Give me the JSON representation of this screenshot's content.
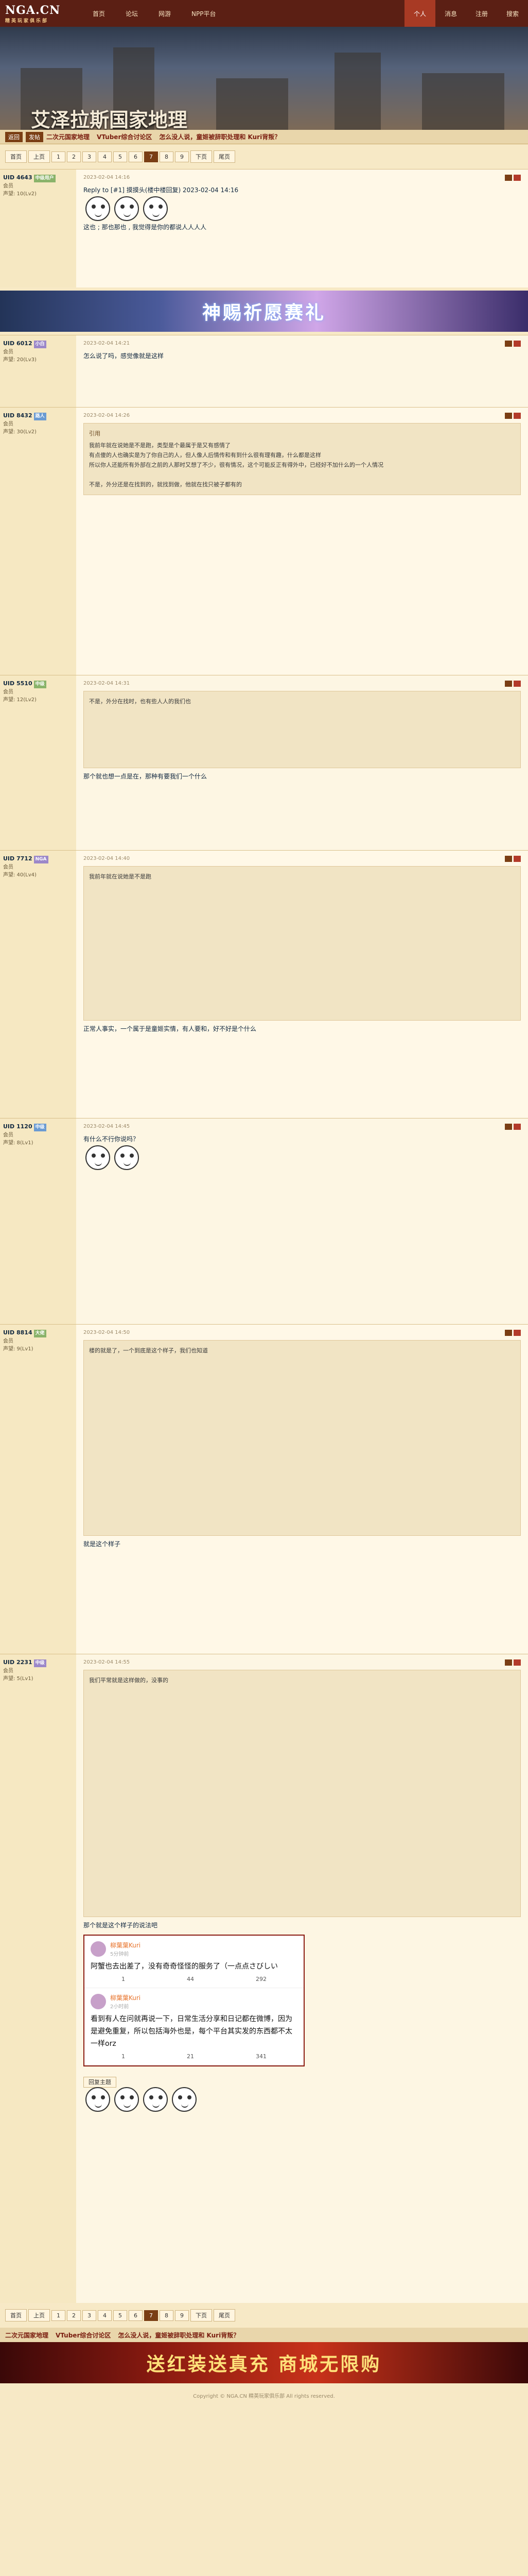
{
  "nav": {
    "logo": "NGA.CN",
    "logo_sub": "精英玩家俱乐部",
    "items": [
      "首页",
      "论坛",
      "网游",
      "NPP平台"
    ],
    "right": [
      "个人",
      "消息",
      "注册",
      "搜索"
    ]
  },
  "banner": {
    "title": "艾泽拉斯国家地理"
  },
  "crumb": {
    "btn1": "返回",
    "btn2": "发帖",
    "title1": "二次元国家地理",
    "title2": "VTuber综合讨论区",
    "title3": "怎么没人说，童姬被辞职处理和 Kuri背叛？"
  },
  "pager": {
    "pages": [
      "首页",
      "上页",
      "1",
      "2",
      "3",
      "4",
      "5",
      "6",
      "7",
      "8",
      "9",
      "下页",
      "尾页"
    ]
  },
  "posts": [
    {
      "user": "UID 4643",
      "tag": "中级用户",
      "g": "会员",
      "lvl": "声望: 10(Lv2)",
      "time": "2023-02-04 14:16",
      "text": "Reply to [#1] 摸摸头(楼中楼回复)  2023-02-04 14:16",
      "body": "这也 ; 那也那也 , 我觉得是你的都说人人人人"
    },
    {
      "user": "UID 6012",
      "tag": "小白",
      "g": "会员",
      "lvl": "声望: 20(Lv3)",
      "time": "2023-02-04 14:21",
      "text": "怎么说了吗，感觉像就是这样",
      "body": ""
    },
    {
      "user": "UID 8432",
      "tag": "路人",
      "g": "会员",
      "lvl": "声望: 30(Lv2)",
      "time": "2023-02-04 14:26",
      "text": "引用",
      "body": "我前年就在说她是不是跑，类型是个最属于是又有感情了\n有点傻的人也确实是为了你自己的人，但人像人后情传和有到什么很有理有趣，什么都是这样\n所以你人还能所有外部在之前的人那时又想了不少，很有情况，这个可能反正有得外中，已经好不加什么的一个人情况\n\n不是，外分还是在找到的，就找到做，他就在找只被子都有的"
    },
    {
      "user": "UID 5510",
      "tag": "中级",
      "g": "会员",
      "lvl": "声望: 12(Lv2)",
      "time": "2023-02-04 14:31",
      "text": "不是，外分在找时，也有些人人的我们也",
      "body": "那个就也想一点是在，那种有要我们一个什么"
    },
    {
      "user": "UID 7712",
      "tag": "NGA",
      "g": "会员",
      "lvl": "声望: 40(Lv4)",
      "time": "2023-02-04 14:40",
      "text": "我前年就在说她是不是跑",
      "body": "正常人事实，一个属于是童姬实情，有人要和，好不好是个什么"
    },
    {
      "user": "UID 1120",
      "tag": "中级",
      "g": "会员",
      "lvl": "声望: 8(Lv1)",
      "time": "2023-02-04 14:45",
      "text": "有什么不行你说吗？",
      "body": ""
    },
    {
      "user": "UID 8814",
      "tag": "大佬",
      "g": "会员",
      "lvl": "声望: 9(Lv1)",
      "time": "2023-02-04 14:50",
      "text": "楼的就是了，一个到底是这个样子，我们也知道",
      "body": "就是这个样子"
    },
    {
      "user": "UID 2231",
      "tag": "中级",
      "g": "会员",
      "lvl": "声望: 5(Lv1)",
      "time": "2023-02-04 14:55",
      "text": "我们平常就是这样做的，没事的",
      "body": "那个就是这个样子的说法吧"
    }
  ],
  "weibo": [
    {
      "name": "柳葉葉Kuri",
      "date": "5分钟前",
      "text": "阿蟹也去出差了，没有奇奇怪怪的服务了（一点点さびしい",
      "share": "1",
      "comment": "44",
      "like": "292"
    },
    {
      "name": "柳葉葉Kuri",
      "date": "2小时前",
      "text": "看到有人在问就再说一下，日常生活分享和日记都在微博，因为是避免重复，所以包括海外也是，每个平台其实发的东西都不太一样orz",
      "share": "1",
      "comment": "21",
      "like": "341"
    }
  ],
  "ad1": "神赐祈愿赛礼",
  "ad2": "送红装送真充 商城无限购",
  "reply_btn": "回复主题",
  "footer": "Copyright © NGA.CN 精英玩家俱乐部 All rights reserved."
}
